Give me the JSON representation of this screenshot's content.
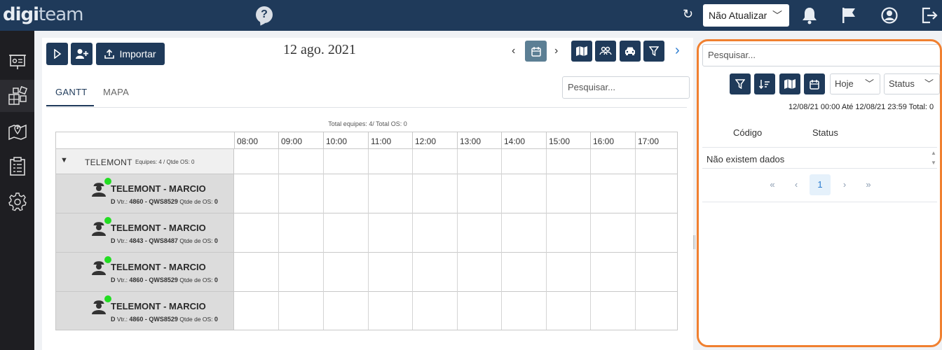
{
  "topbar": {
    "logo_bold": "digi",
    "logo_light": "team",
    "help_icon": "?",
    "refresh_icon": "↻",
    "update_select": {
      "value": "Não Atualizar"
    },
    "icons": [
      "bell-icon",
      "flag-icon",
      "user-circle-icon",
      "logout-icon"
    ]
  },
  "sidebar": {
    "items": [
      "dashboard-icon",
      "modules-icon",
      "map-pin-icon",
      "clipboard-icon",
      "gear-icon"
    ]
  },
  "toolbar": {
    "import_label": "Importar",
    "date": "12 ago. 2021"
  },
  "tabs": [
    {
      "label": "GANTT",
      "active": true
    },
    {
      "label": "MAPA",
      "active": false
    }
  ],
  "main_search": {
    "placeholder": "Pesquisar..."
  },
  "gantt": {
    "totals": "Total equipes: 4/ Total OS: 0",
    "hours": [
      "08:00",
      "09:00",
      "10:00",
      "11:00",
      "12:00",
      "13:00",
      "14:00",
      "15:00",
      "16:00",
      "17:00"
    ],
    "group": {
      "name": "TELEMONT",
      "meta": "Equipes: 4 / Qtde OS: 0"
    },
    "techs": [
      {
        "name": "TELEMONT - MARCIO",
        "prefix": "D",
        "vtr_label": "Vtr.:",
        "vtr": "4860 - QWS8529",
        "os_label": "Qtde de OS:",
        "os": "0",
        "status_color": "#22dd22"
      },
      {
        "name": "TELEMONT - MARCIO",
        "prefix": "D",
        "vtr_label": "Vtr.:",
        "vtr": "4843 - QWS8487",
        "os_label": "Qtde de OS:",
        "os": "0",
        "status_color": "#22dd22"
      },
      {
        "name": "TELEMONT - MARCIO",
        "prefix": "D",
        "vtr_label": "Vtr.:",
        "vtr": "4860 - QWS8529",
        "os_label": "Qtde de OS:",
        "os": "0",
        "status_color": "#22dd22"
      },
      {
        "name": "TELEMONT - MARCIO",
        "prefix": "D",
        "vtr_label": "Vtr.:",
        "vtr": "4860 - QWS8529",
        "os_label": "Qtde de OS:",
        "os": "0",
        "status_color": "#22dd22"
      }
    ]
  },
  "right_panel": {
    "search_placeholder": "Pesquisar...",
    "period_select": "Hoje",
    "status_select": "Status",
    "range": "12/08/21 00:00 Até 12/08/21 23:59 Total: 0",
    "col_code": "Código",
    "col_status": "Status",
    "empty": "Não existem dados",
    "pager": {
      "first": "«",
      "prev": "‹",
      "page": "1",
      "next": "›",
      "last": "»"
    }
  },
  "colors": {
    "navy": "#1f3a5a",
    "highlight": "#f08030",
    "online": "#22dd22"
  }
}
